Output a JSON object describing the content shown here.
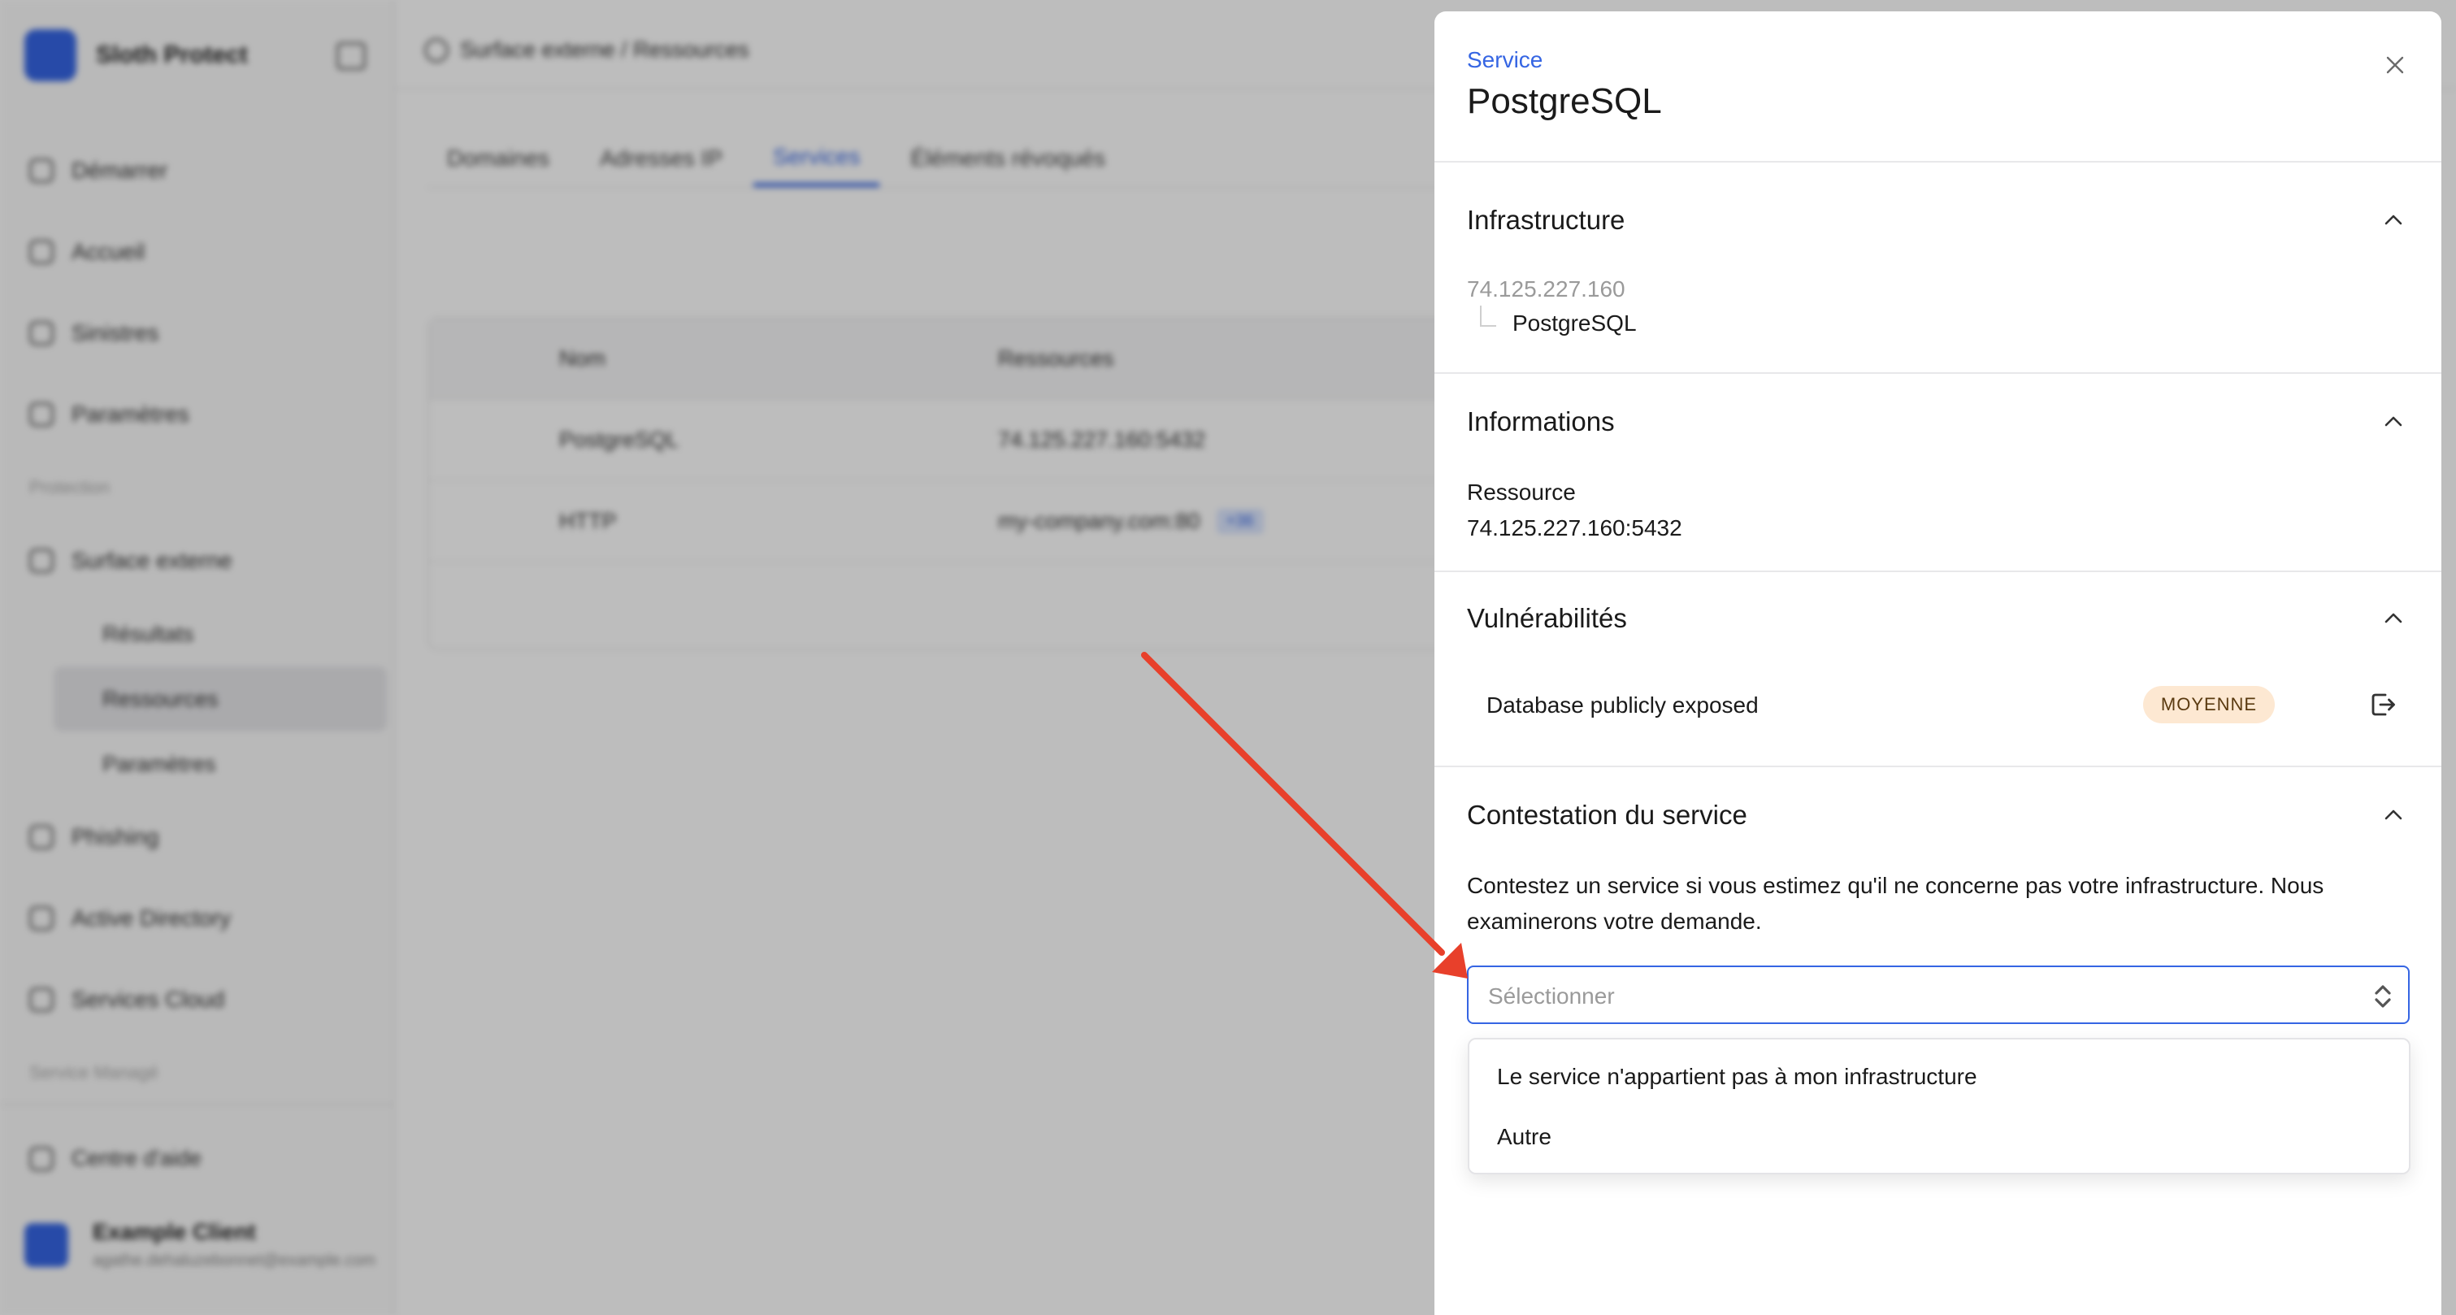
{
  "app": {
    "brand_name": "Sloth Protect",
    "nav": [
      {
        "label": "Démarrer"
      },
      {
        "label": "Accueil"
      },
      {
        "label": "Sinistres"
      },
      {
        "label": "Paramètres"
      }
    ],
    "section_label": "Protection",
    "surface_label": "Surface externe",
    "sub_items": [
      {
        "label": "Résultats"
      },
      {
        "label": "Ressources"
      },
      {
        "label": "Paramètres"
      }
    ],
    "more_nav": [
      {
        "label": "Phishing"
      },
      {
        "label": "Active Directory"
      },
      {
        "label": "Services Cloud"
      }
    ],
    "managed_label": "Service Managé",
    "help_label": "Centre d'aide",
    "client_name": "Example Client",
    "client_email": "agathe.dehaluzebonnet@example.com",
    "breadcrumb": "Surface externe / Ressources",
    "tabs": [
      "Domaines",
      "Adresses IP",
      "Services",
      "Éléments révoqués"
    ],
    "table": {
      "headers": [
        "Nom",
        "Ressources"
      ],
      "rows": [
        {
          "name": "PostgreSQL",
          "resource": "74.125.227.160:5432",
          "tag": ""
        },
        {
          "name": "HTTP",
          "resource": "my-company.com:80",
          "tag": "+36"
        }
      ]
    }
  },
  "drawer": {
    "eyebrow": "Service",
    "title": "PostgreSQL",
    "infrastructure": {
      "title": "Infrastructure",
      "ip": "74.125.227.160",
      "child": "PostgreSQL"
    },
    "informations": {
      "title": "Informations",
      "label": "Ressource",
      "value": "74.125.227.160:5432"
    },
    "vulnerabilities": {
      "title": "Vulnérabilités",
      "items": [
        {
          "name": "Database publicly exposed",
          "severity": "MOYENNE",
          "severity_color": "#fde8d2"
        }
      ]
    },
    "contest": {
      "title": "Contestation du service",
      "text": "Contestez un service si vous estimez qu'il ne concerne pas votre infrastructure. Nous examinerons votre demande.",
      "placeholder": "Sélectionner",
      "options": [
        "Le service n'appartient pas à mon infrastructure",
        "Autre"
      ]
    }
  },
  "colors": {
    "accent": "#3565e3",
    "annotation_arrow": "#e8402b",
    "badge_bg": "#fde8d2"
  }
}
